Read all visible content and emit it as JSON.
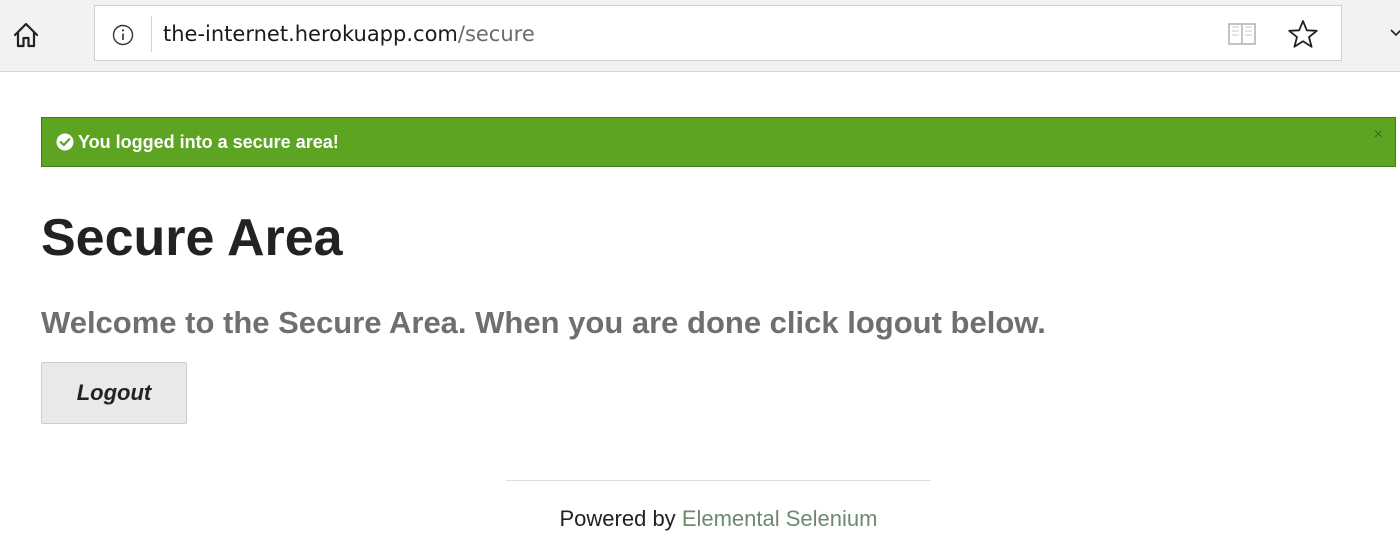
{
  "browser": {
    "url_host": "the-internet.herokuapp.com",
    "url_path": "/secure",
    "icons": {
      "home": "home-icon",
      "info": "info-icon",
      "reader": "reading-view-icon",
      "favorite": "star-icon",
      "overflow": "chevron-down-icon"
    }
  },
  "flash": {
    "message": "You logged into a secure area!",
    "close_label": "×",
    "color": "#5da423"
  },
  "page": {
    "title": "Secure Area",
    "subheader": "Welcome to the Secure Area. When you are done click logout below.",
    "logout_label": "Logout"
  },
  "footer": {
    "prefix": "Powered by",
    "link_label": "Elemental Selenium"
  }
}
